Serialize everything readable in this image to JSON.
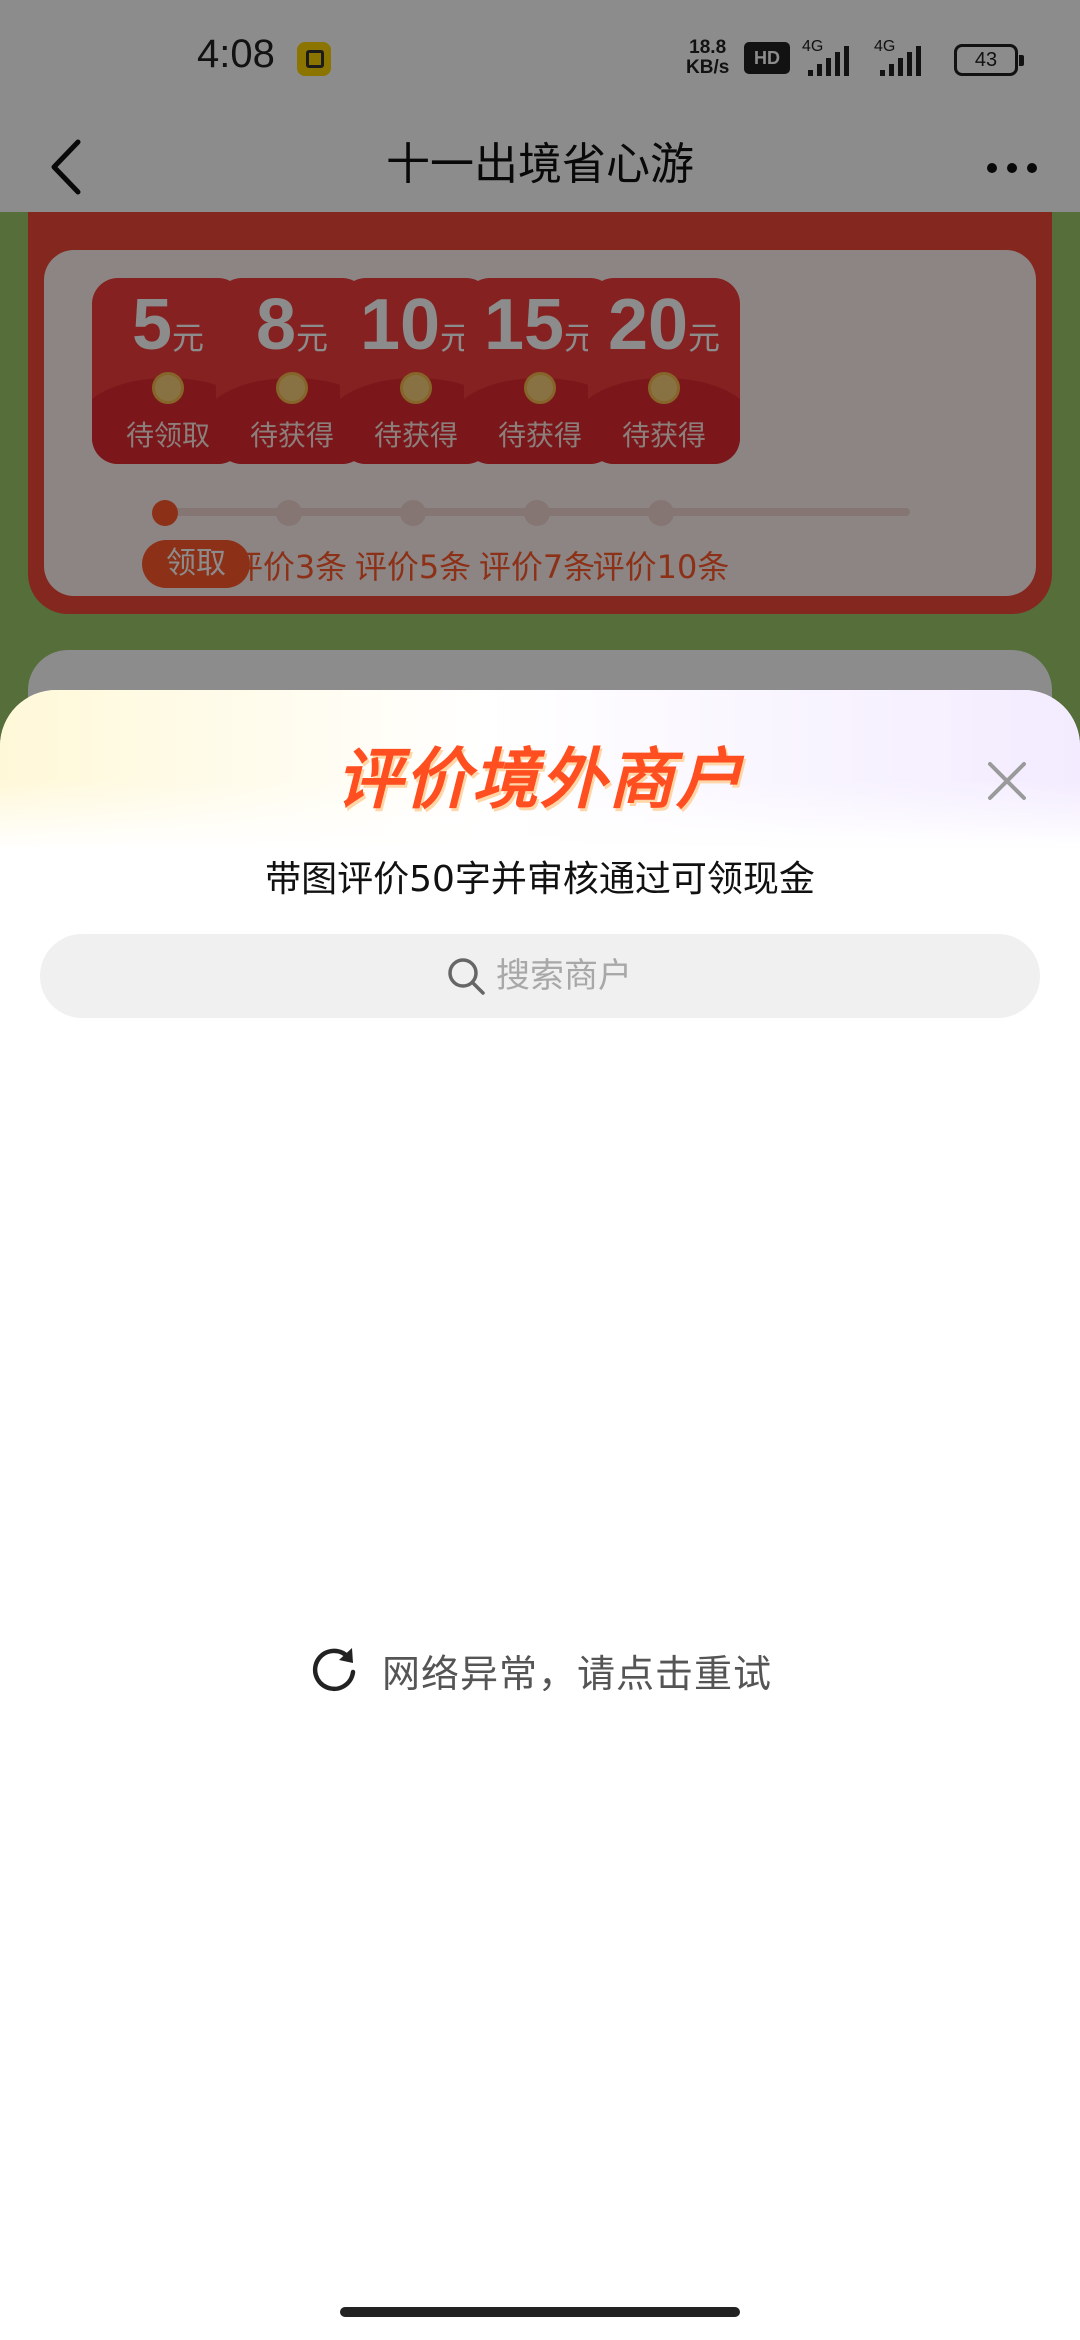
{
  "status_bar": {
    "time": "4:08",
    "net_speed_value": "18.8",
    "net_speed_unit": "KB/s",
    "hd_label": "HD",
    "signal1_label": "4G",
    "signal2_label": "4G",
    "battery": "43"
  },
  "nav": {
    "title": "十一出境省心游",
    "back_icon": "chevron-left-icon",
    "more_icon": "more-horizontal-icon"
  },
  "rewards": {
    "envelopes": [
      {
        "amount": "5",
        "unit": "元",
        "state": "待领取"
      },
      {
        "amount": "8",
        "unit": "元",
        "state": "待获得"
      },
      {
        "amount": "10",
        "unit": "元",
        "state": "待获得"
      },
      {
        "amount": "15",
        "unit": "元",
        "state": "待获得"
      },
      {
        "amount": "20",
        "unit": "元",
        "state": "待获得"
      }
    ],
    "steps": [
      "领取",
      "评价3条",
      "评价5条",
      "评价7条",
      "评价10条"
    ],
    "progress_step": 1
  },
  "sheet": {
    "title": "评价境外商户",
    "subtitle": "带图评价50字并审核通过可领现金",
    "search_placeholder": "搜索商户",
    "error_text": "网络异常，请点击重试"
  },
  "colors": {
    "accent": "#ff5a2d",
    "envelope": "#f23c3c",
    "background_green": "#9bc86a"
  }
}
